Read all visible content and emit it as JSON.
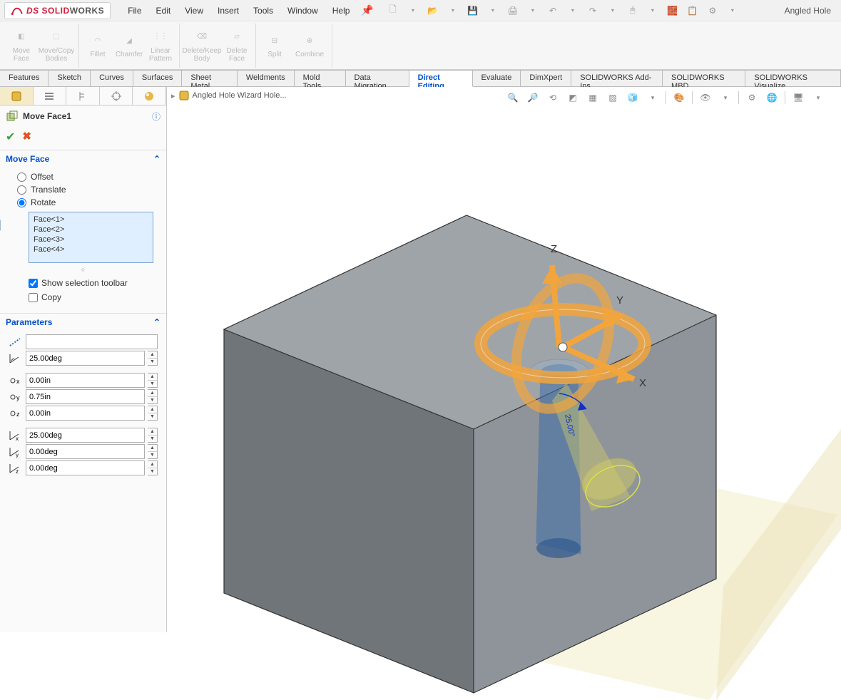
{
  "app": {
    "name_solid": "SOLID",
    "name_works": "WORKS",
    "doc_title": "Angled Hole"
  },
  "menu": {
    "file": "File",
    "edit": "Edit",
    "view": "View",
    "insert": "Insert",
    "tools": "Tools",
    "window": "Window",
    "help": "Help"
  },
  "ribbon": {
    "move_face": "Move\nFace",
    "move_copy": "Move/Copy\nBodies",
    "fillet": "Fillet",
    "chamfer": "Chamfer",
    "linear_pattern": "Linear\nPattern",
    "delete_keep": "Delete/Keep\nBody",
    "delete_face": "Delete\nFace",
    "split": "Split",
    "combine": "Combine"
  },
  "tabs": {
    "features": "Features",
    "sketch": "Sketch",
    "curves": "Curves",
    "surfaces": "Surfaces",
    "sheet_metal": "Sheet Metal",
    "weldments": "Weldments",
    "mold_tools": "Mold Tools",
    "data_migration": "Data Migration",
    "direct_editing": "Direct Editing",
    "evaluate": "Evaluate",
    "dimxpert": "DimXpert",
    "addins": "SOLIDWORKS Add-Ins",
    "mbd": "SOLIDWORKS MBD",
    "visualize": "SOLIDWORKS Visualize"
  },
  "panel": {
    "feature_name": "Move Face1",
    "section_move": "Move Face",
    "opt_offset": "Offset",
    "opt_translate": "Translate",
    "opt_rotate": "Rotate",
    "faces": [
      "Face<1>",
      "Face<2>",
      "Face<3>",
      "Face<4>"
    ],
    "show_selection_toolbar": "Show selection toolbar",
    "copy": "Copy",
    "section_params": "Parameters",
    "axis": "",
    "angle": "25.00deg",
    "cx": "0.00in",
    "cy": "0.75in",
    "cz": "0.00in",
    "rx": "25.00deg",
    "ry": "0.00deg",
    "rz": "0.00deg"
  },
  "breadcrumb": {
    "item": "Angled Hole Wizard Hole..."
  },
  "axes": {
    "x": "X",
    "y": "Y",
    "z": "Z"
  },
  "triad_angle": "25.00°"
}
